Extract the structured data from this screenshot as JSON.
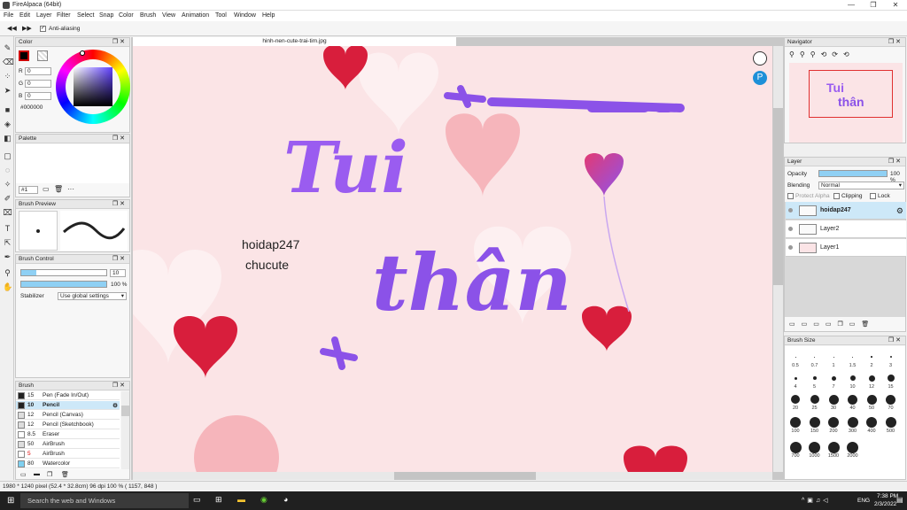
{
  "window": {
    "title": "FireAlpaca (64bit)",
    "min": "—",
    "max": "❐",
    "close": "✕"
  },
  "menu": [
    "File",
    "Edit",
    "Layer",
    "Filter",
    "Select",
    "Snap",
    "Color",
    "Brush",
    "View",
    "Animation",
    "Tool",
    "Window",
    "Help"
  ],
  "tool_options": {
    "anti_aliasing": "Anti-aliasing"
  },
  "color_panel": {
    "title": "Color",
    "r_label": "R",
    "r": "0",
    "g_label": "G",
    "g": "0",
    "b_label": "B",
    "b": "0",
    "hex": "#000000"
  },
  "palette_panel": {
    "title": "Palette",
    "selector": "#1",
    "more": "···"
  },
  "brush_preview": {
    "title": "Brush Preview"
  },
  "brush_control": {
    "title": "Brush Control",
    "size": "10",
    "opacity": "100 %",
    "stabilizer_label": "Stabilizer",
    "stabilizer_value": "Use global settings"
  },
  "brush_panel": {
    "title": "Brush",
    "items": [
      {
        "size": "15",
        "name": "Pen (Fade In/Out)",
        "color": "#222222"
      },
      {
        "size": "10",
        "name": "Pencil",
        "color": "#222222",
        "selected": true
      },
      {
        "size": "12",
        "name": "Pencil (Canvas)",
        "color": "#dddddd"
      },
      {
        "size": "12",
        "name": "Pencil (Sketchbook)",
        "color": "#dddddd"
      },
      {
        "size": "8.5",
        "name": "Eraser",
        "color": "#ffffff"
      },
      {
        "size": "50",
        "name": "AirBrush",
        "color": "#dddddd"
      },
      {
        "size": "5",
        "name": "AirBrush",
        "color": "#ffffff"
      },
      {
        "size": "80",
        "name": "Watercolor",
        "color": "#7fd0f0"
      }
    ]
  },
  "canvas": {
    "tab": "hinh-nen-cute-trai-tim.jpg",
    "text_line1": "hoidap247",
    "text_line2": "chucute",
    "handwriting_top": "Tui",
    "handwriting_bottom": "thân"
  },
  "navigator": {
    "title": "Navigator"
  },
  "layer_panel": {
    "title": "Layer",
    "opacity_label": "Opacity",
    "opacity": "100 %",
    "blending_label": "Blending",
    "blending": "Normal",
    "protect_alpha": "Protect Alpha",
    "clipping": "Clipping",
    "lock": "Lock",
    "layers": [
      {
        "name": "hoidap247",
        "selected": true
      },
      {
        "name": "Layer2"
      },
      {
        "name": "Layer1"
      }
    ]
  },
  "brush_size": {
    "title": "Brush Size",
    "rows": [
      [
        "0.5",
        "0.7",
        "1",
        "1.5",
        "2",
        "3"
      ],
      [
        "4",
        "5",
        "7",
        "10",
        "12",
        "15"
      ],
      [
        "20",
        "25",
        "30",
        "40",
        "50",
        "70"
      ],
      [
        "100",
        "150",
        "200",
        "300",
        "400",
        "500"
      ],
      [
        "700",
        "1000",
        "1500",
        "2000"
      ]
    ]
  },
  "status": {
    "text": "1980 * 1240 pixel  (52.4 * 32.8cm)  96 dpi  100 %  ( 1157, 848 )"
  },
  "taskbar": {
    "search": "Search the web and Windows",
    "lang": "ENG",
    "time": "7:38 PM",
    "date": "2/3/2022"
  },
  "colors": {
    "accent": "#7ec6ee",
    "heart_red": "#d81e3c",
    "heart_pink": "#f6b5bb",
    "purple": "#8b52e8"
  }
}
